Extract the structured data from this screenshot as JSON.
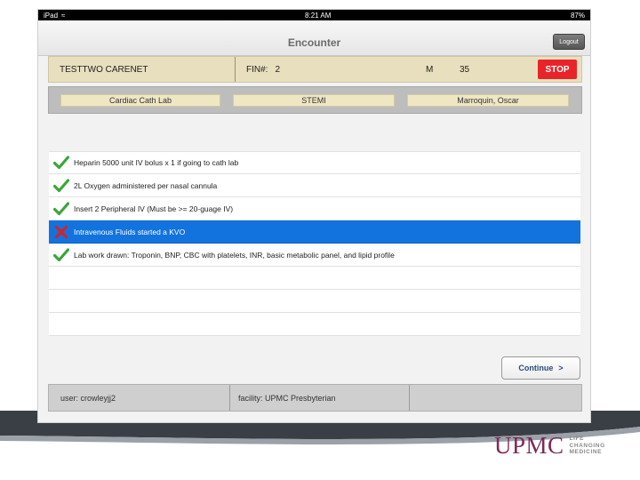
{
  "statusbar": {
    "device": "iPad",
    "time": "8:21 AM",
    "battery": "87%"
  },
  "nav": {
    "title": "Encounter",
    "logout_label": "Logout"
  },
  "patient": {
    "name": "TESTTWO CARENET",
    "fin_label": "FIN#:",
    "fin_value": "2",
    "sex": "M",
    "age": "35",
    "stop_label": "STOP"
  },
  "info": {
    "location": "Cardiac Cath Lab",
    "condition": "STEMI",
    "physician": "Marroquin, Oscar"
  },
  "checklist": [
    {
      "text": "Heparin 5000 unit IV bolus x 1 if going to cath lab",
      "status": "done"
    },
    {
      "text": "2L Oxygen administered per nasal cannula",
      "status": "done"
    },
    {
      "text": "Insert 2 Peripheral IV (Must be >= 20-guage IV)",
      "status": "done"
    },
    {
      "text": "Intravenous Fluids started a KVO",
      "status": "not-done"
    },
    {
      "text": "Lab work drawn: Troponin, BNP, CBC with platelets, INR, basic metabolic panel, and lipid profile",
      "status": "done"
    }
  ],
  "continue": {
    "label": "Continue",
    "chevron": ">"
  },
  "footer": {
    "user": "user: crowleyjj2",
    "facility": "facility: UPMC Presbyterian"
  },
  "brand": {
    "logo": "UPMC",
    "tagline_1": "LIFE",
    "tagline_2": "CHANGING",
    "tagline_3": "MEDICINE"
  },
  "colors": {
    "accent": "#1273de",
    "stop": "#e8242a",
    "check": "#3aa63a",
    "cross": "#d2232a",
    "brand": "#7a2a5a"
  }
}
